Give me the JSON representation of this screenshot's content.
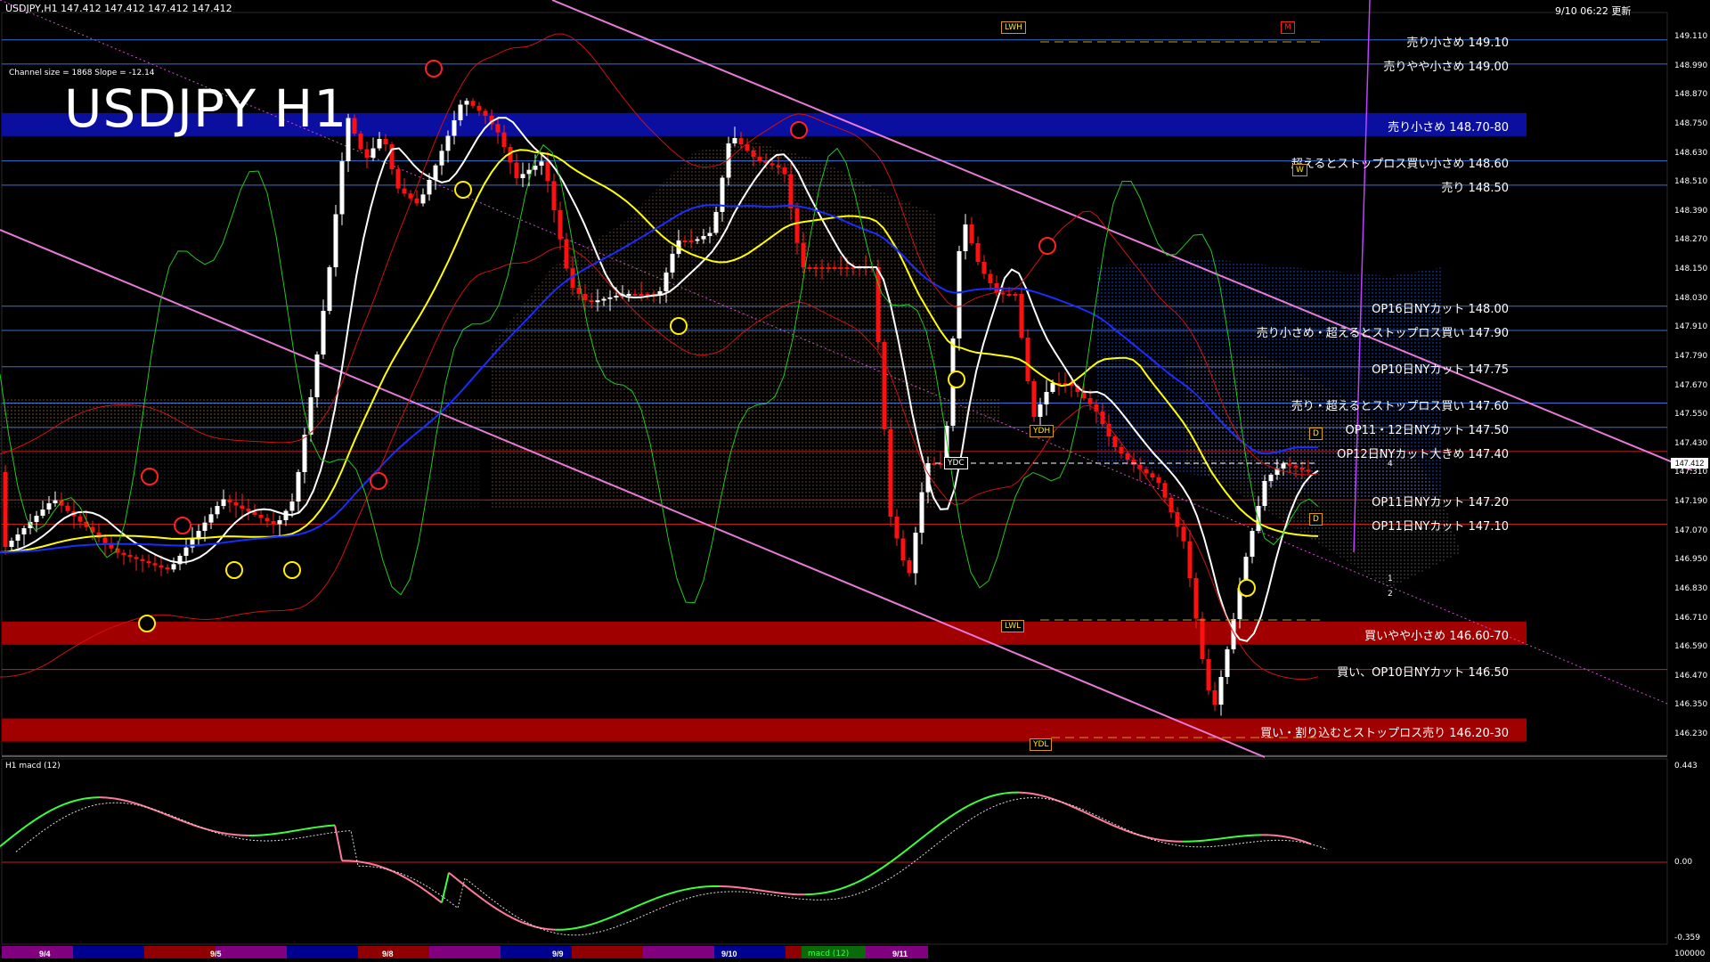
{
  "header": {
    "symbol_info": "USDJPY,H1  147.412 147.412 147.412 147.412",
    "timestamp": "9/10 06:22 更新",
    "channel_info": "Channel size = 1868 Slope = -12.14",
    "title": "USDJPY H1"
  },
  "levels": [
    {
      "label": "売り小さめ 149.10",
      "price": 149.1
    },
    {
      "label": "売りやや小さめ 149.00",
      "price": 149.0
    },
    {
      "label": "売り小さめ 148.70-80",
      "price": 148.75,
      "band": true,
      "color": "#0a0fa0"
    },
    {
      "label": "超えるとストップロス買い小さめ 148.60",
      "price": 148.6
    },
    {
      "label": "売り 148.50",
      "price": 148.5
    },
    {
      "label": "OP16日NYカット 148.00",
      "price": 148.0
    },
    {
      "label": "売り小さめ・超えるとストップロス買い 147.90",
      "price": 147.9
    },
    {
      "label": "OP10日NYカット 147.75",
      "price": 147.75
    },
    {
      "label": "売り・超えるとストップロス買い 147.60",
      "price": 147.6
    },
    {
      "label": "OP11・12日NYカット 147.50",
      "price": 147.5
    },
    {
      "label": "OP12日NYカット大きめ 147.40",
      "price": 147.4
    },
    {
      "label": "OP11日NYカット 147.20",
      "price": 147.2
    },
    {
      "label": "OP11日NYカット 147.10",
      "price": 147.1
    },
    {
      "label": "買いやや小さめ 146.60-70",
      "price": 146.65,
      "band": true,
      "color": "#a00000"
    },
    {
      "label": "買い、OP10日NYカット 146.50",
      "price": 146.5
    },
    {
      "label": "買い・割り込むとストップロス売り 146.20-30",
      "price": 146.25,
      "band": true,
      "color": "#a00000"
    }
  ],
  "y_axis": [
    "149.110",
    "148.990",
    "148.870",
    "148.750",
    "148.630",
    "148.510",
    "148.390",
    "148.270",
    "148.150",
    "148.030",
    "147.910",
    "147.790",
    "147.670",
    "147.550",
    "147.430",
    "147.310",
    "147.190",
    "147.070",
    "146.950",
    "146.830",
    "146.710",
    "146.590",
    "146.470",
    "146.350",
    "146.230"
  ],
  "current_price": "147.412",
  "macd": {
    "label": "H1  macd (12)",
    "y_axis": [
      "0.443",
      "0.00",
      "-0.359"
    ]
  },
  "tags": {
    "lwh": "LWH",
    "m": "M",
    "w": "W",
    "ydh": "YDH",
    "ydc": "YDC",
    "lwl": "LWL",
    "ydl": "YDL",
    "d": "D",
    "n1": "1",
    "n2": "2",
    "n4": "4"
  },
  "dates": [
    "9/4",
    "9/5",
    "9/8",
    "9/9",
    "9/10",
    "9/11"
  ],
  "bottom_bar": {
    "legend": "macd (12)",
    "right_value": "100000"
  },
  "colors": {
    "ema_white": "#ffffff",
    "ema_yellow": "#ffff00",
    "ema_blue": "#1a2cff",
    "bollinger": "#d01010",
    "rsi": "#22c81e",
    "channel": "#e87ad8",
    "level_line": "#3b6fd9",
    "macd_up": "#3cff3c",
    "macd_down": "#ff7a9a"
  }
}
